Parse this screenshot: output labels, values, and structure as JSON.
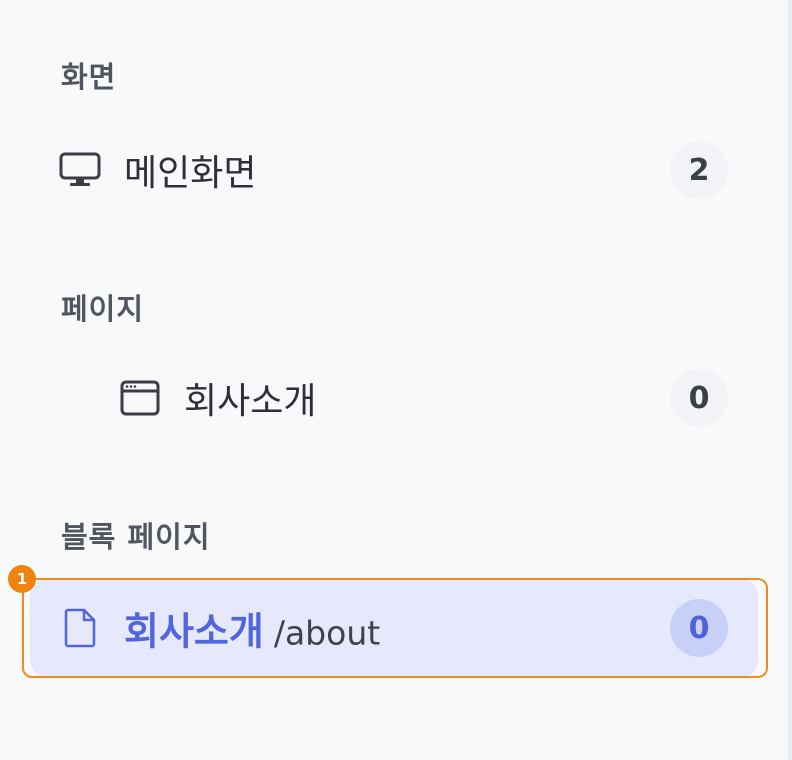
{
  "sections": [
    {
      "title": "화면",
      "items": [
        {
          "icon": "monitor-icon",
          "label": "메인화면",
          "count": "2"
        }
      ]
    },
    {
      "title": "페이지",
      "items": [
        {
          "icon": "browser-window-icon",
          "label": "회사소개",
          "count": "0"
        }
      ]
    },
    {
      "title": "블록 페이지",
      "items": [
        {
          "icon": "document-icon",
          "label": "회사소개",
          "path": "/about",
          "count": "0",
          "selected": true
        }
      ]
    }
  ],
  "annotation": {
    "marker": "1"
  },
  "colors": {
    "accent": "#5165de",
    "selected_background": "#e6e9fb",
    "highlight_border": "#f08a1f"
  }
}
